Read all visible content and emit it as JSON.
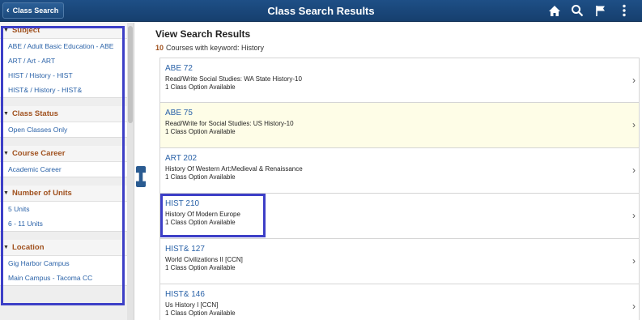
{
  "header": {
    "back_label": "Class Search",
    "title": "Class Search Results",
    "icons": [
      "home-icon",
      "search-icon",
      "flag-icon",
      "more-vert-icon"
    ]
  },
  "facets": [
    {
      "title": "Subject",
      "items": [
        "ABE / Adult Basic Education - ABE",
        "ART / Art - ART",
        "HIST / History - HIST",
        "HIST& / History - HIST&"
      ]
    },
    {
      "title": "Class Status",
      "items": [
        "Open Classes Only"
      ]
    },
    {
      "title": "Course Career",
      "items": [
        "Academic Career"
      ]
    },
    {
      "title": "Number of Units",
      "items": [
        "5 Units",
        "6 - 11 Units"
      ]
    },
    {
      "title": "Location",
      "items": [
        "Gig Harbor Campus",
        "Main Campus - Tacoma CC"
      ]
    }
  ],
  "results": {
    "heading": "View Search Results",
    "count": "10",
    "count_text": "Courses with keyword: History",
    "rows": [
      {
        "code": "ABE 72",
        "title": "Read/Write Social Studies: WA State History-10",
        "options": "1 Class Option Available"
      },
      {
        "code": "ABE 75",
        "title": "Read/Write for Social Studies: US History-10",
        "options": "1 Class Option Available"
      },
      {
        "code": "ART 202",
        "title": "History Of Western Art:Medieval & Renaissance",
        "options": "1 Class Option Available"
      },
      {
        "code": "HIST 210",
        "title": "History Of Modern Europe",
        "options": "1 Class Option Available"
      },
      {
        "code": "HIST& 127",
        "title": "World Civilizations II [CCN]",
        "options": "1 Class Option Available"
      },
      {
        "code": "HIST& 146",
        "title": "Us History I [CCN]",
        "options": "1 Class Option Available"
      }
    ]
  },
  "colors": {
    "header_bg": "#1e4f86",
    "facet_title": "#a0511e",
    "link": "#2a62a8",
    "highlight_row": "#fefde7",
    "annotation_box": "#3d3fc7"
  }
}
